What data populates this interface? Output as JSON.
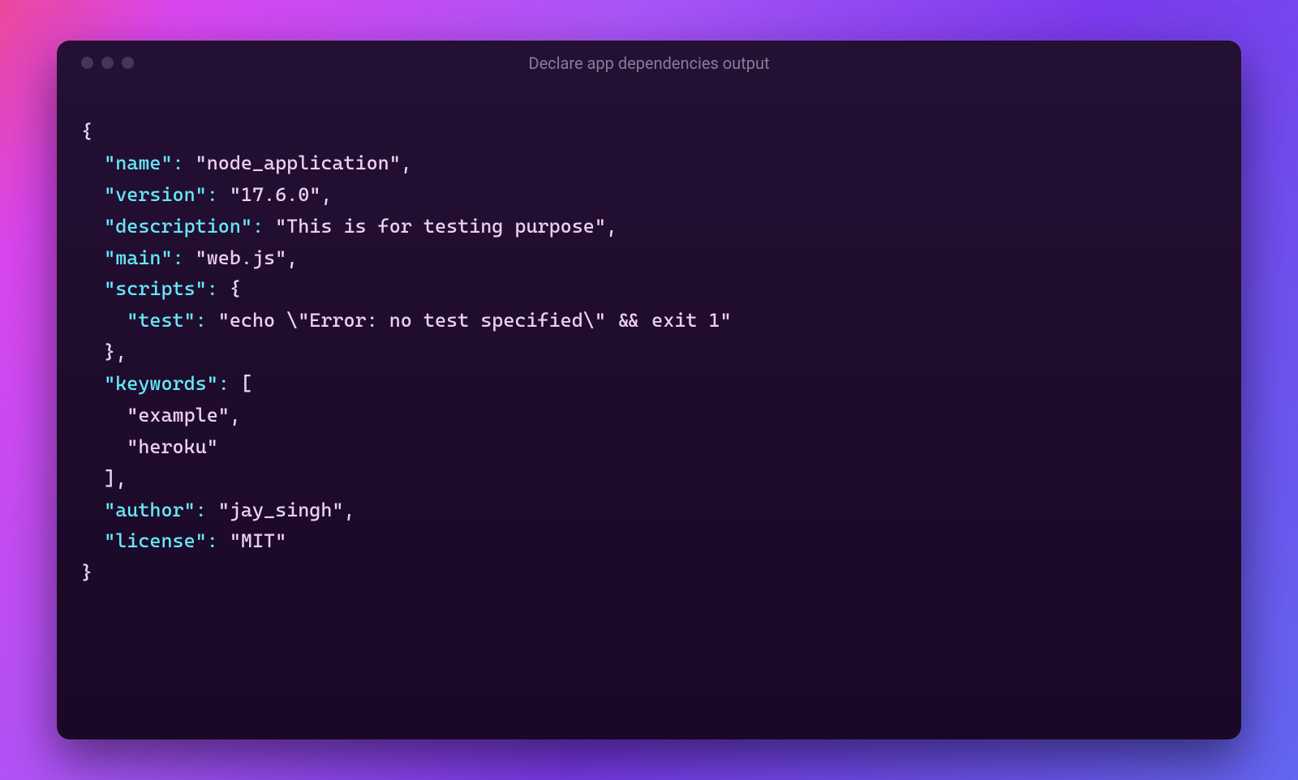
{
  "window": {
    "title": "Declare app dependencies output"
  },
  "package_json": {
    "keys": {
      "name": "\"name\"",
      "version": "\"version\"",
      "description": "\"description\"",
      "main": "\"main\"",
      "scripts": "\"scripts\"",
      "test": "\"test\"",
      "keywords": "\"keywords\"",
      "author": "\"author\"",
      "license": "\"license\""
    },
    "values": {
      "name": "\"node_application\"",
      "version": "\"17.6.0\"",
      "description": "\"This is for testing purpose\"",
      "main": "\"web.js\"",
      "test": "\"echo \\\"Error: no test specified\\\" && exit 1\"",
      "keyword_0": "\"example\"",
      "keyword_1": "\"heroku\"",
      "author": "\"jay_singh\"",
      "license": "\"MIT\""
    }
  },
  "syntax": {
    "open_brace": "{",
    "close_brace": "}",
    "open_bracket": "[",
    "close_bracket": "]",
    "close_bracket_comma": "],",
    "close_brace_comma": "},",
    "colon_space": ": ",
    "comma": ","
  },
  "colors": {
    "key_color": "#67e8f9",
    "string_color": "#eecff0",
    "punct_color": "#e9d5ff",
    "bg_terminal": "#1e0a2e",
    "bg_gradient_start": "#ec4899",
    "bg_gradient_end": "#6366f1"
  }
}
